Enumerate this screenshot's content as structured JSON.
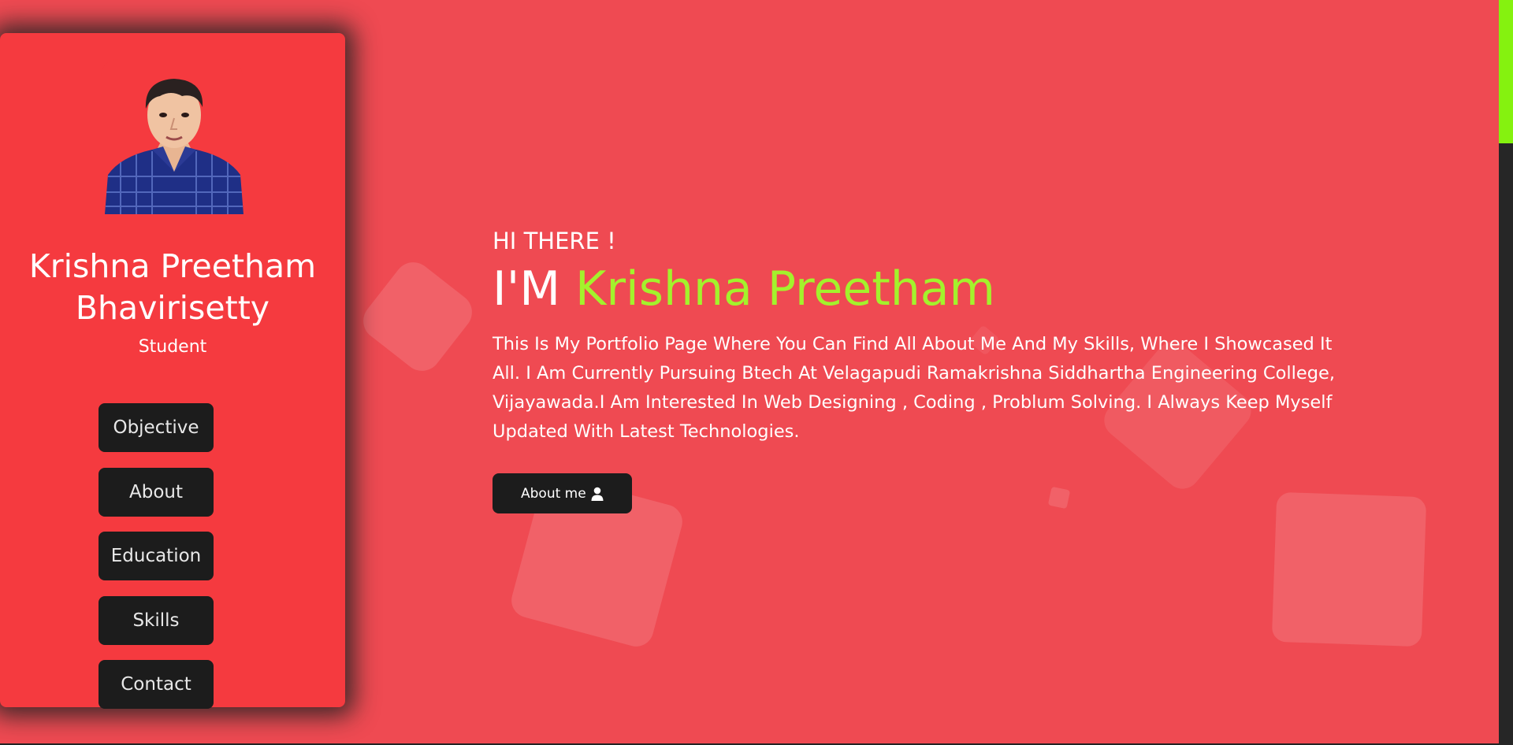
{
  "colors": {
    "background": "#ef4a52",
    "sidebar": "#f53a3f",
    "button": "#1c1c1c",
    "accent": "#a3f22c",
    "scroll_thumb": "#85f20f"
  },
  "sidebar": {
    "avatar_alt": "profile photo",
    "name": "Krishna Preetham Bhavirisetty",
    "role": "Student",
    "nav": [
      {
        "label": "Objective"
      },
      {
        "label": "About"
      },
      {
        "label": "Education"
      },
      {
        "label": "Skills"
      },
      {
        "label": "Contact"
      }
    ]
  },
  "hero": {
    "greeting": "HI THERE !",
    "headline_prefix": "I'M",
    "headline_name": "Krishna Preetham",
    "intro": "This Is My Portfolio Page Where You Can Find All About Me And My Skills, Where I Showcased It All. I Am Currently Pursuing Btech At Velagapudi Ramakrishna Siddhartha Engineering College, Vijayawada.I Am Interested In Web Designing , Coding , Problum Solving. I Always Keep Myself Updated With Latest Technologies.",
    "cta_label": "About me",
    "cta_icon": "user-icon"
  }
}
